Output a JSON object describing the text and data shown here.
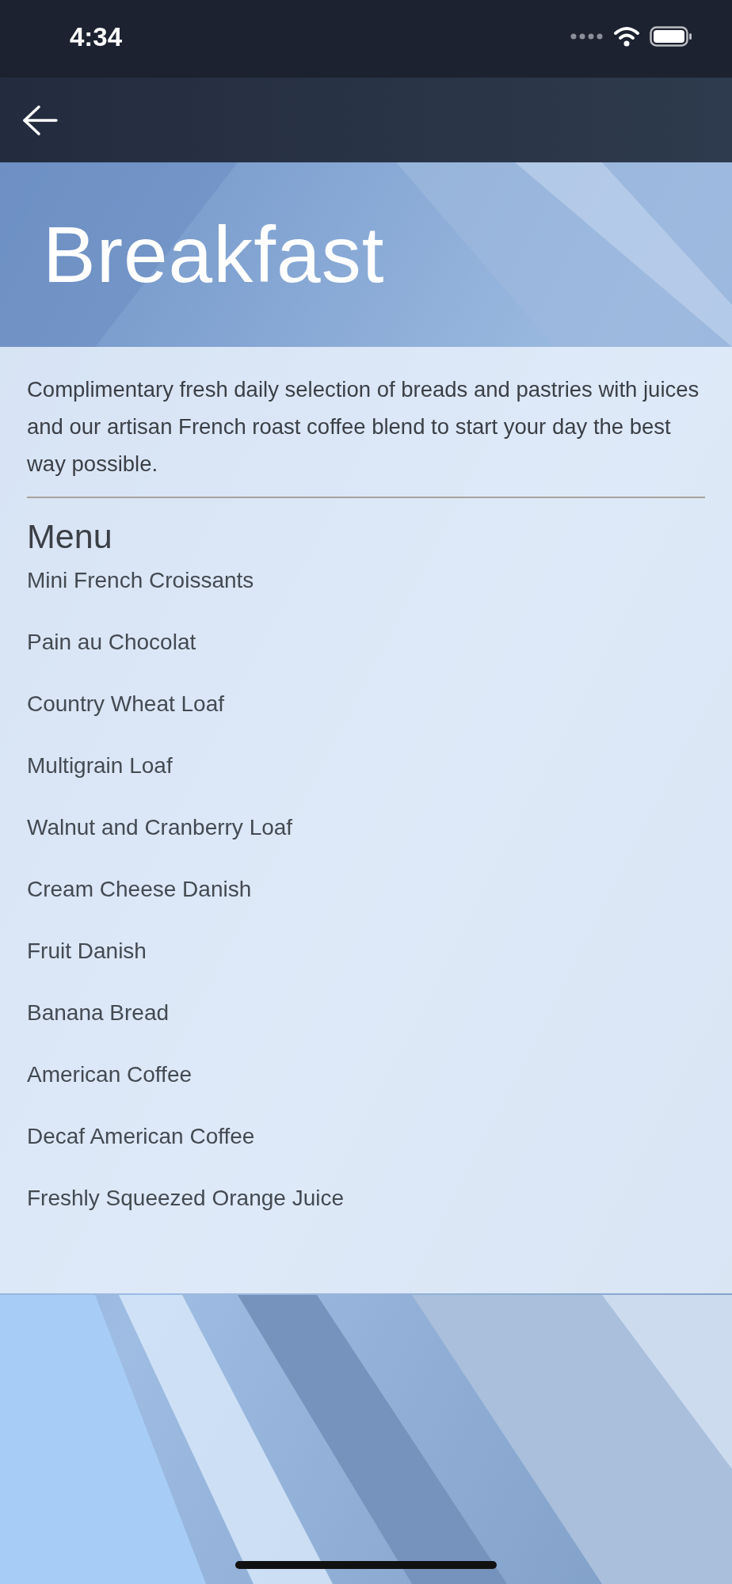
{
  "status_bar": {
    "time": "4:34"
  },
  "header": {
    "title": "Breakfast"
  },
  "description": "Complimentary fresh daily selection of breads and pastries with juices and our artisan French roast coffee blend to start your day the best way possible.",
  "menu": {
    "heading": "Menu",
    "items": [
      "Mini French Croissants",
      "Pain au Chocolat",
      "Country Wheat Loaf",
      "Multigrain Loaf",
      "Walnut and Cranberry Loaf",
      "Cream Cheese Danish",
      "Fruit Danish",
      "Banana Bread",
      "American Coffee",
      "Decaf American Coffee",
      "Freshly Squeezed Orange Juice"
    ]
  }
}
